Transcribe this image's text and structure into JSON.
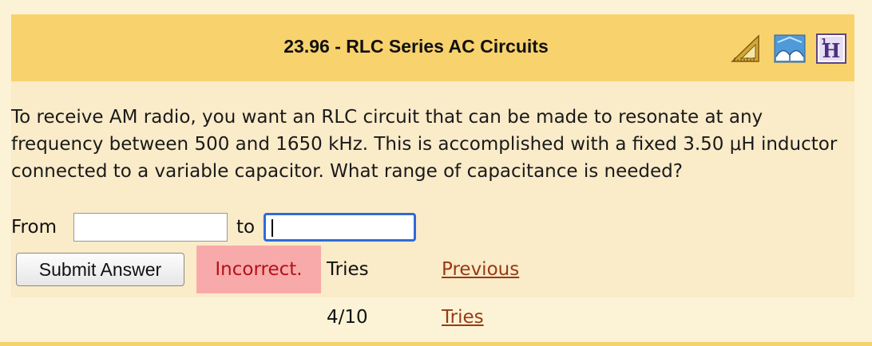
{
  "header": {
    "title": "23.96 - RLC Series AC Circuits",
    "icons": [
      "calculator-ruler-icon",
      "book-icon",
      "help-icon"
    ]
  },
  "question": {
    "text": "To receive AM radio, you want an RLC circuit that can be made to resonate at any frequency between 500 and 1650 kHz. This is accomplished with a fixed 3.50 μH inductor connected to a variable capacitor. What range of capacitance is needed?"
  },
  "answer": {
    "from_label": "From",
    "from_value": "",
    "to_label": "to",
    "to_value": ""
  },
  "submit": {
    "button_label": "Submit Answer",
    "status": "Incorrect.",
    "tries": "Tries 4/10",
    "previous_tries_label": "Previous Tries"
  },
  "colors": {
    "header_bg": "#f8d26d",
    "panel_bg": "#faebc9",
    "incorrect_bg": "#f8aaaa",
    "incorrect_text": "#b2111b",
    "link": "#973a15",
    "focus_border": "#2f6bd8"
  }
}
